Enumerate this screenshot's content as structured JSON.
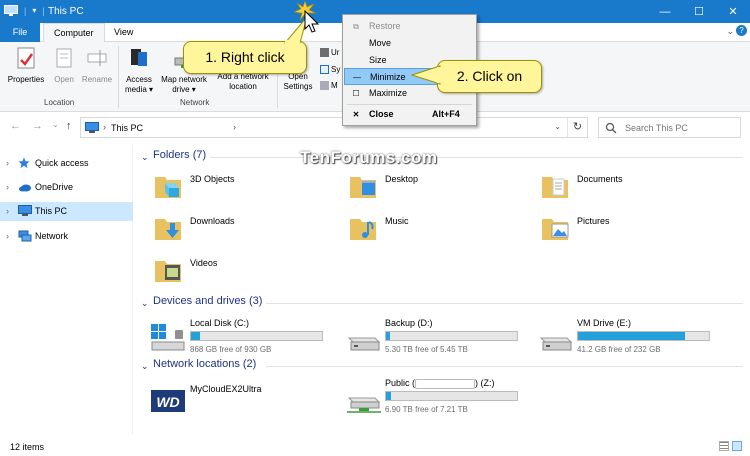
{
  "window": {
    "title": "This PC",
    "minimize_glyph": "—",
    "maximize_glyph": "☐",
    "close_glyph": "✕"
  },
  "ribbon": {
    "tabs": {
      "file": "File",
      "computer": "Computer",
      "view": "View"
    },
    "location": {
      "properties": "Properties",
      "open": "Open",
      "rename": "Rename",
      "group_label": "Location"
    },
    "network": {
      "access_media_line1": "Access",
      "access_media_line2": "media ▾",
      "map_drive_line1": "Map network",
      "map_drive_line2": "drive ▾",
      "add_location_line1": "Add a network",
      "add_location_line2": "location",
      "group_label": "Network"
    },
    "system": {
      "open_settings_line1": "Open",
      "open_settings_line2": "Settings",
      "sys_item1": "Ur",
      "sys_item2": "Sy",
      "sys_item3": "M"
    }
  },
  "address": {
    "path": "This PC",
    "search_placeholder": "Search This PC"
  },
  "nav": {
    "items": [
      {
        "label": "Quick access",
        "icon": "star-icon"
      },
      {
        "label": "OneDrive",
        "icon": "cloud-icon"
      },
      {
        "label": "This PC",
        "icon": "computer-icon",
        "selected": true
      },
      {
        "label": "Network",
        "icon": "network-icon"
      }
    ]
  },
  "sections": {
    "folders": "Folders (7)",
    "devices": "Devices and drives (3)",
    "network": "Network locations (2)"
  },
  "folders": [
    {
      "name": "3D Objects",
      "icon": "3d-objects-icon"
    },
    {
      "name": "Desktop",
      "icon": "desktop-folder-icon"
    },
    {
      "name": "Documents",
      "icon": "documents-folder-icon"
    },
    {
      "name": "Downloads",
      "icon": "downloads-folder-icon"
    },
    {
      "name": "Music",
      "icon": "music-folder-icon"
    },
    {
      "name": "Pictures",
      "icon": "pictures-folder-icon"
    },
    {
      "name": "Videos",
      "icon": "videos-folder-icon"
    }
  ],
  "drives": [
    {
      "name": "Local Disk (C:)",
      "free": "868 GB free of 930 GB",
      "used_fraction": 0.07
    },
    {
      "name": "Backup (D:)",
      "free": "5.30 TB free of 5.45 TB",
      "used_fraction": 0.03
    },
    {
      "name": "VM Drive (E:)",
      "free": "41.2 GB free of 232 GB",
      "used_fraction": 0.82
    }
  ],
  "network_locations": [
    {
      "name": "MyCloudEX2Ultra",
      "icon": "wd-icon"
    },
    {
      "name_prefix": "Public (",
      "name_suffix": ") (Z:)",
      "free": "6.90 TB free of 7.21 TB",
      "used_fraction": 0.04
    }
  ],
  "status": {
    "count": "12 items"
  },
  "context_menu": {
    "restore": "Restore",
    "move": "Move",
    "size": "Size",
    "minimize": "Minimize",
    "maximize": "Maximize",
    "close": "Close",
    "close_shortcut": "Alt+F4"
  },
  "callouts": {
    "right_click": "1. Right click",
    "click_on": "2. Click on"
  },
  "watermark": "TenForums.com",
  "colors": {
    "titlebar": "#1979ca",
    "accent": "#1979ca",
    "selection": "#cce8ff",
    "drive_fill": "#26a0da",
    "callout": "#fff59b",
    "menu_highlight": "#91c9f7"
  }
}
